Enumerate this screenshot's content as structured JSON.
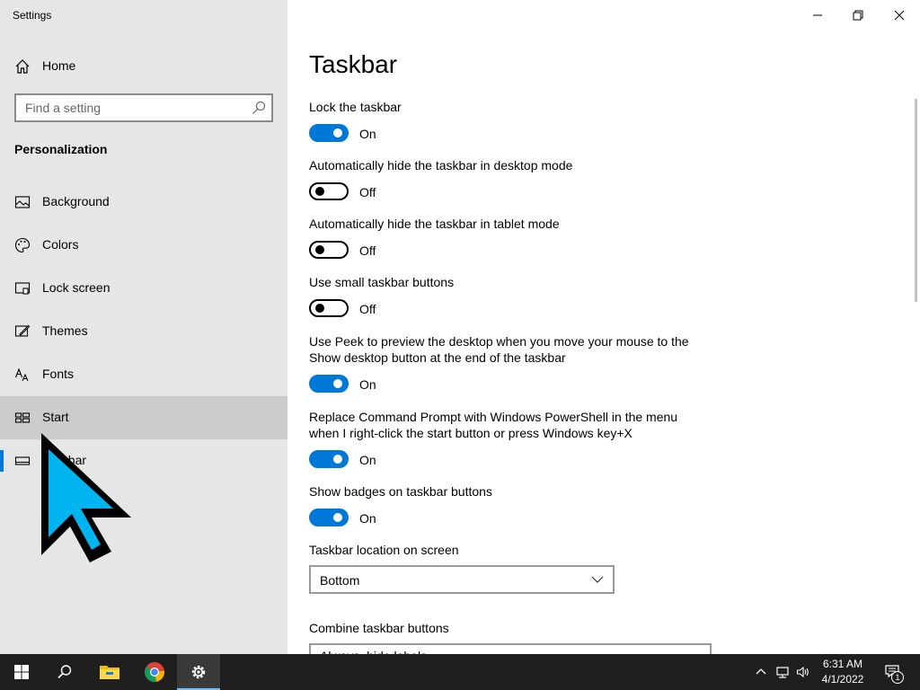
{
  "window": {
    "title": "Settings",
    "controls": [
      "minimize-icon",
      "restore-icon",
      "close-icon"
    ]
  },
  "sidebar": {
    "home_label": "Home",
    "search_placeholder": "Find a setting",
    "section_title": "Personalization",
    "items": [
      {
        "label": "Background",
        "icon": "background-icon"
      },
      {
        "label": "Colors",
        "icon": "palette-icon"
      },
      {
        "label": "Lock screen",
        "icon": "lock-screen-icon"
      },
      {
        "label": "Themes",
        "icon": "themes-icon"
      },
      {
        "label": "Fonts",
        "icon": "fonts-icon"
      },
      {
        "label": "Start",
        "icon": "start-icon",
        "state": "hover"
      },
      {
        "label": "Taskbar",
        "icon": "taskbar-icon",
        "state": "selected"
      }
    ]
  },
  "main": {
    "title": "Taskbar",
    "settings": [
      {
        "label": "Lock the taskbar",
        "state": "On"
      },
      {
        "label": "Automatically hide the taskbar in desktop mode",
        "state": "Off"
      },
      {
        "label": "Automatically hide the taskbar in tablet mode",
        "state": "Off"
      },
      {
        "label": "Use small taskbar buttons",
        "state": "Off"
      },
      {
        "label": "Use Peek to preview the desktop when you move your mouse to the Show desktop button at the end of the taskbar",
        "state": "On"
      },
      {
        "label": "Replace Command Prompt with Windows PowerShell in the menu when I right-click the start button or press Windows key+X",
        "state": "On"
      },
      {
        "label": "Show badges on taskbar buttons",
        "state": "On"
      }
    ],
    "location_label": "Taskbar location on screen",
    "location_value": "Bottom",
    "combine_label": "Combine taskbar buttons",
    "combine_value": "Always, hide labels"
  },
  "taskbar": {
    "apps": [
      "start-button",
      "search-button",
      "file-explorer",
      "chrome",
      "settings"
    ],
    "time": "6:31 AM",
    "date": "4/1/2022",
    "notification_count": "1"
  },
  "colors": {
    "accent": "#0078d7",
    "sidebar_bg": "#e6e6e6",
    "taskbar_bg": "#1f1f1f",
    "cursor": "#00b4f0"
  }
}
